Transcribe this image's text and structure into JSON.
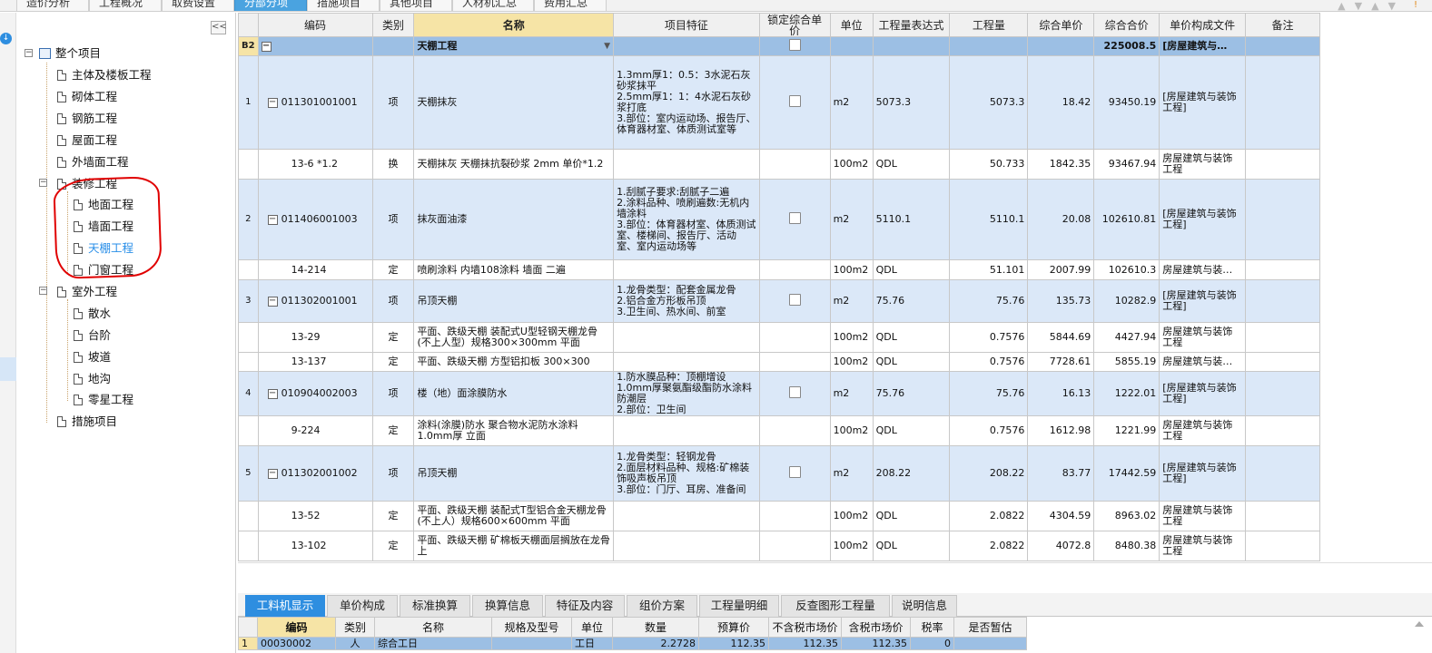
{
  "top_tabs": [
    {
      "label": "造价分析",
      "active": false
    },
    {
      "label": "工程概况",
      "active": false
    },
    {
      "label": "取费设置",
      "active": false
    },
    {
      "label": "分部分项",
      "active": true
    },
    {
      "label": "措施项目",
      "active": false
    },
    {
      "label": "其他项目",
      "active": false
    },
    {
      "label": "人材机汇总",
      "active": false
    },
    {
      "label": "费用汇总",
      "active": false
    }
  ],
  "tree": {
    "root": "整个项目",
    "items": [
      {
        "label": "主体及楼板工程"
      },
      {
        "label": "砌体工程"
      },
      {
        "label": "钢筋工程"
      },
      {
        "label": "屋面工程"
      },
      {
        "label": "外墙面工程"
      },
      {
        "label": "装修工程"
      },
      {
        "label": "地面工程"
      },
      {
        "label": "墙面工程"
      },
      {
        "label": "天棚工程"
      },
      {
        "label": "门窗工程"
      },
      {
        "label": "室外工程"
      },
      {
        "label": "散水"
      },
      {
        "label": "台阶"
      },
      {
        "label": "坡道"
      },
      {
        "label": "地沟"
      },
      {
        "label": "零星工程"
      },
      {
        "label": "措施项目"
      }
    ]
  },
  "grid": {
    "headers": [
      "编码",
      "类别",
      "名称",
      "项目特征",
      "锁定综合单价",
      "单位",
      "工程量表达式",
      "工程量",
      "综合单价",
      "综合合价",
      "单价构成文件",
      "备注"
    ],
    "section": {
      "row": "B2",
      "name": "天棚工程",
      "total": "225008.5",
      "file": "[房屋建筑与…"
    },
    "rows": [
      {
        "rn": "1",
        "code": "011301001001",
        "cat": "项",
        "name": "天棚抹灰",
        "feat": [
          "1.3mm厚1：0.5：3水泥石灰砂浆抹平",
          "2.5mm厚1：1：4水泥石灰砂浆打底",
          "3.部位：室内运动场、报告厅、体育器材室、体质测试室等"
        ],
        "unit": "m2",
        "expr": "5073.3",
        "qty": "5073.3",
        "price": "18.42",
        "total": "93450.19",
        "file": "[房屋建筑与装饰工程]",
        "type": "qi"
      },
      {
        "rn": "",
        "code": "13-6 *1.2",
        "cat": "换",
        "name": "天棚抹灰 天棚抹抗裂砂浆 2mm  单价*1.2",
        "feat": [],
        "unit": "100m2",
        "expr": "QDL",
        "qty": "50.733",
        "price": "1842.35",
        "total": "93467.94",
        "file": "房屋建筑与装饰工程",
        "type": "sub"
      },
      {
        "rn": "2",
        "code": "011406001003",
        "cat": "项",
        "name": "抹灰面油漆",
        "feat": [
          "1.刮腻子要求:刮腻子二遍",
          "2.涂料品种、喷刷遍数:无机内墙涂料",
          "3.部位：体育器材室、体质测试室、楼梯间、报告厅、活动室、室内运动场等"
        ],
        "unit": "m2",
        "expr": "5110.1",
        "qty": "5110.1",
        "price": "20.08",
        "total": "102610.81",
        "file": "[房屋建筑与装饰工程]",
        "type": "qi"
      },
      {
        "rn": "",
        "code": "14-214",
        "cat": "定",
        "name": "喷刷涂料 内墙108涂料 墙面 二遍",
        "feat": [],
        "unit": "100m2",
        "expr": "QDL",
        "qty": "51.101",
        "price": "2007.99",
        "total": "102610.3",
        "file": "房屋建筑与装…",
        "type": "sub"
      },
      {
        "rn": "3",
        "code": "011302001001",
        "cat": "项",
        "name": "吊顶天棚",
        "feat": [
          "1.龙骨类型：配套金属龙骨",
          "2.铝合金方形板吊顶",
          "3.卫生间、热水间、前室"
        ],
        "unit": "m2",
        "expr": "75.76",
        "qty": "75.76",
        "price": "135.73",
        "total": "10282.9",
        "file": "[房屋建筑与装饰工程]",
        "type": "qi"
      },
      {
        "rn": "",
        "code": "13-29",
        "cat": "定",
        "name": "平面、跌级天棚 装配式U型轻钢天棚龙骨(不上人型）规格300×300mm 平面",
        "feat": [],
        "unit": "100m2",
        "expr": "QDL",
        "qty": "0.7576",
        "price": "5844.69",
        "total": "4427.94",
        "file": "房屋建筑与装饰工程",
        "type": "sub"
      },
      {
        "rn": "",
        "code": "13-137",
        "cat": "定",
        "name": "平面、跌级天棚 方型铝扣板 300×300",
        "feat": [],
        "unit": "100m2",
        "expr": "QDL",
        "qty": "0.7576",
        "price": "7728.61",
        "total": "5855.19",
        "file": "房屋建筑与装…",
        "type": "sub"
      },
      {
        "rn": "4",
        "code": "010904002003",
        "cat": "项",
        "name": "楼（地）面涂膜防水",
        "feat": [
          "1.防水膜品种：顶棚增设1.0mm厚聚氨酯级酯防水涂料防潮层",
          "2.部位：卫生间"
        ],
        "unit": "m2",
        "expr": "75.76",
        "qty": "75.76",
        "price": "16.13",
        "total": "1222.01",
        "file": "[房屋建筑与装饰工程]",
        "type": "qi"
      },
      {
        "rn": "",
        "code": "9-224",
        "cat": "定",
        "name": "涂料(涂膜)防水 聚合物水泥防水涂料1.0mm厚 立面",
        "feat": [],
        "unit": "100m2",
        "expr": "QDL",
        "qty": "0.7576",
        "price": "1612.98",
        "total": "1221.99",
        "file": "房屋建筑与装饰工程",
        "type": "sub"
      },
      {
        "rn": "5",
        "code": "011302001002",
        "cat": "项",
        "name": "吊顶天棚",
        "feat": [
          "1.龙骨类型：轻钢龙骨",
          "2.面层材料品种、规格:矿棉装饰吸声板吊顶",
          "3.部位：门厅、耳房、准备间"
        ],
        "unit": "m2",
        "expr": "208.22",
        "qty": "208.22",
        "price": "83.77",
        "total": "17442.59",
        "file": "[房屋建筑与装饰工程]",
        "type": "qi"
      },
      {
        "rn": "",
        "code": "13-52",
        "cat": "定",
        "name": "平面、跌级天棚 装配式T型铝合金天棚龙骨(不上人）规格600×600mm 平面",
        "feat": [],
        "unit": "100m2",
        "expr": "QDL",
        "qty": "2.0822",
        "price": "4304.59",
        "total": "8963.02",
        "file": "房屋建筑与装饰工程",
        "type": "sub"
      },
      {
        "rn": "",
        "code": "13-102",
        "cat": "定",
        "name": "平面、跌级天棚 矿棉板天棚面层搁放在龙骨上",
        "feat": [],
        "unit": "100m2",
        "expr": "QDL",
        "qty": "2.0822",
        "price": "4072.8",
        "total": "8480.38",
        "file": "房屋建筑与装饰工程",
        "type": "sub"
      }
    ]
  },
  "bottom_tabs": [
    "工料机显示",
    "单价构成",
    "标准换算",
    "换算信息",
    "特征及内容",
    "组价方案",
    "工程量明细",
    "反查图形工程量",
    "说明信息"
  ],
  "bottom_grid": {
    "headers": [
      "编码",
      "类别",
      "名称",
      "规格及型号",
      "单位",
      "数量",
      "预算价",
      "不含税市场价",
      "含税市场价",
      "税率",
      "是否暂估"
    ],
    "row": {
      "rn": "1",
      "code": "00030002",
      "cat": "人",
      "name": "综合工日",
      "spec": "",
      "unit": "工日",
      "qty": "2.2728",
      "budget": "112.35",
      "market": "112.35",
      "market_tax": "112.35",
      "tax": "0",
      "est": ""
    }
  },
  "icons": {
    "collapse": "double-chevron-left-icon",
    "folder": "document-icon",
    "download": "download-icon"
  },
  "colors": {
    "accent": "#2e8ee0",
    "section_row": "#9cbfe4",
    "item_row": "#dbe8f8",
    "header_highlight": "#f6e4a6",
    "annotation": "#e00000"
  }
}
